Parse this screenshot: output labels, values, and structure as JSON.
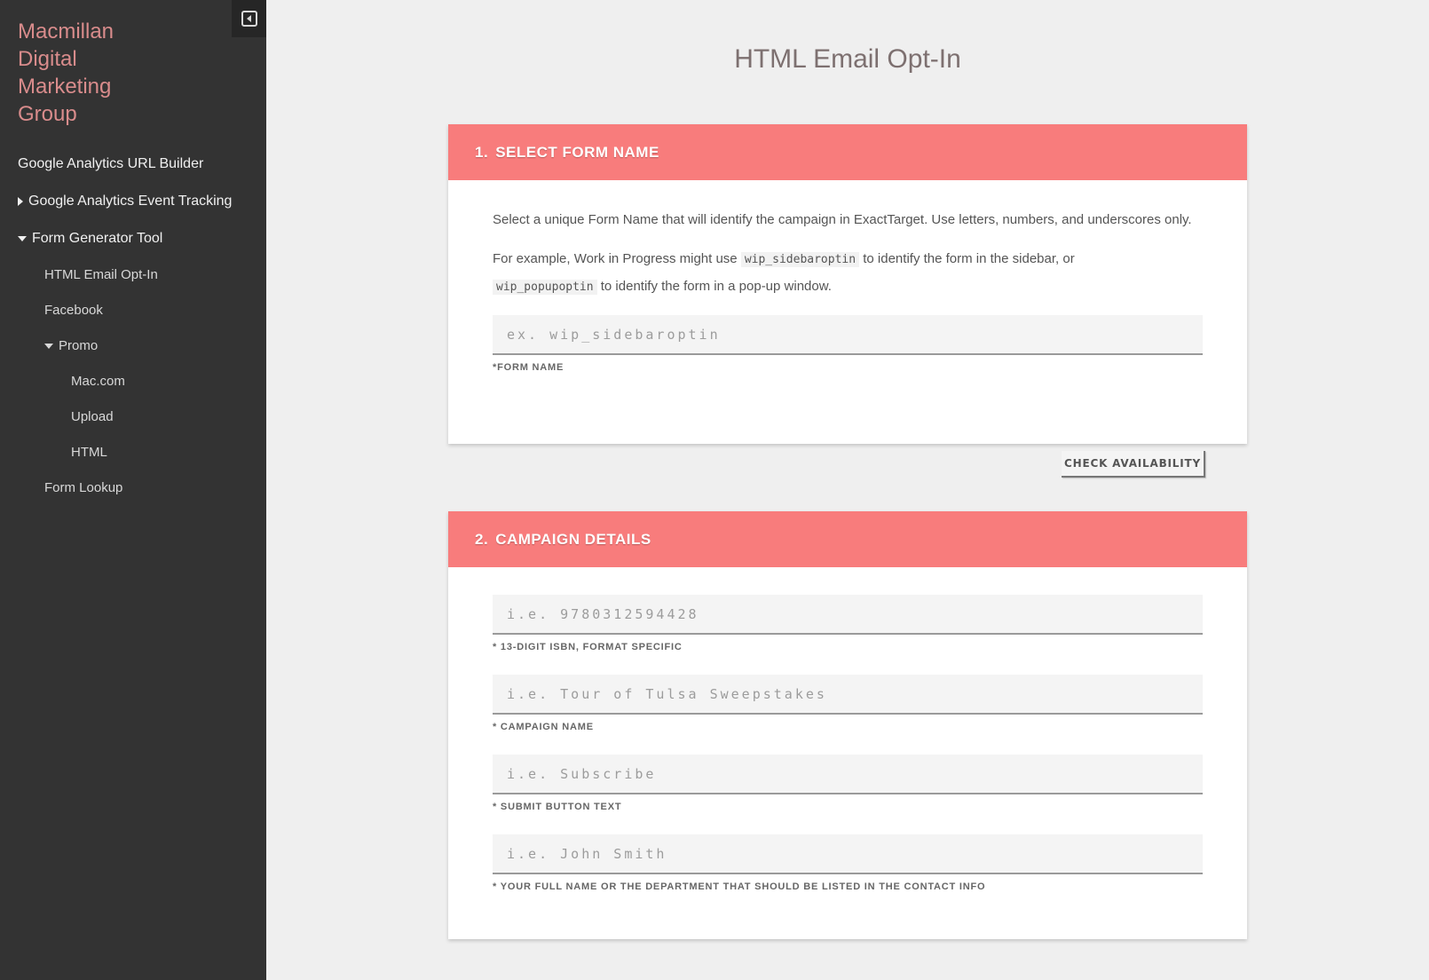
{
  "brand": {
    "lines": [
      "Macmillan",
      "Digital",
      "Marketing",
      "Group"
    ]
  },
  "sidebar": {
    "collapse_icon": "collapse-left-icon",
    "items": [
      {
        "label": "Google Analytics URL Builder"
      },
      {
        "label": "Google Analytics Event Tracking",
        "icon": "triangle-right-icon"
      },
      {
        "label": "Form Generator Tool",
        "icon": "triangle-down-icon"
      },
      {
        "label": "HTML Email Opt-In"
      },
      {
        "label": "Facebook"
      },
      {
        "label": "Promo",
        "icon": "triangle-down-icon"
      },
      {
        "label": "Mac.com"
      },
      {
        "label": "Upload"
      },
      {
        "label": "HTML"
      },
      {
        "label": "Form Lookup"
      }
    ]
  },
  "page": {
    "title": "HTML Email Opt-In"
  },
  "section1": {
    "num": "1.",
    "title": "SELECT FORM NAME",
    "desc1": "Select a unique Form Name that will identify the campaign in ExactTarget. Use letters, numbers, and underscores only.",
    "desc2_pre": "For example, Work in Progress might use",
    "code1": "wip_sidebaroptin",
    "desc2_mid": "to identify the form in the sidebar, or",
    "code2": "wip_popupoptin",
    "desc2_post": "to identify the form in a pop-up window.",
    "input_placeholder": "ex. wip_sidebaroptin",
    "input_label": "*FORM NAME",
    "check_button": "CHECK AVAILABILITY"
  },
  "section2": {
    "num": "2.",
    "title": "CAMPAIGN DETAILS",
    "fields": [
      {
        "placeholder": "i.e. 9780312594428",
        "label": "* 13-DIGIT ISBN, FORMAT SPECIFIC"
      },
      {
        "placeholder": "i.e. Tour of Tulsa Sweepstakes",
        "label": "* CAMPAIGN NAME"
      },
      {
        "placeholder": "i.e. Subscribe",
        "label": "* SUBMIT BUTTON TEXT"
      },
      {
        "placeholder": "i.e. John Smith",
        "label": "* YOUR FULL NAME OR THE DEPARTMENT THAT SHOULD BE LISTED IN THE CONTACT INFO"
      }
    ]
  },
  "colors": {
    "sidebar_bg": "#333333",
    "brand": "#d98c8c",
    "section_header": "#f87c7c",
    "page_bg": "#efefef"
  }
}
